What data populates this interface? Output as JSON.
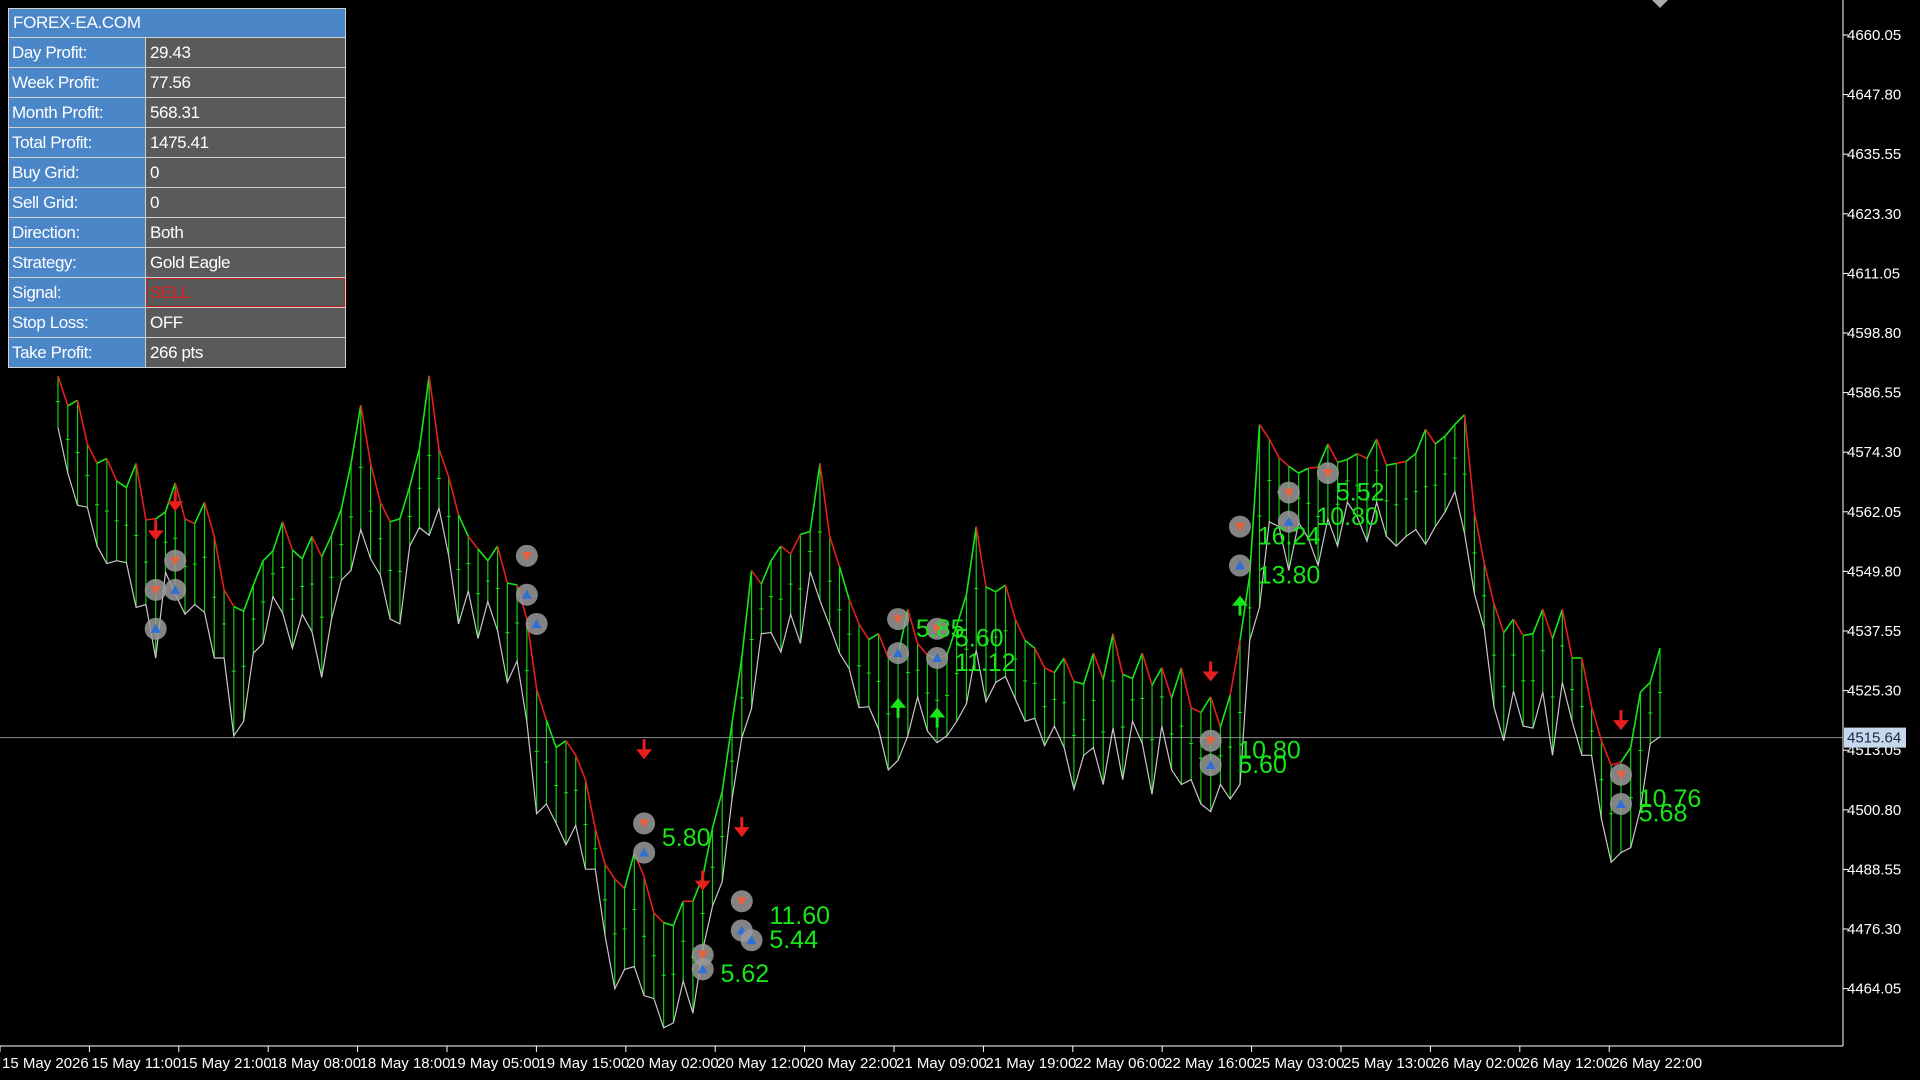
{
  "panel": {
    "title": "FOREX-EA.COM",
    "rows": [
      {
        "label": "Day Profit:",
        "value": "29.43"
      },
      {
        "label": "Week Profit:",
        "value": "77.56"
      },
      {
        "label": "Month Profit:",
        "value": "568.31"
      },
      {
        "label": "Total Profit:",
        "value": "1475.41"
      },
      {
        "label": "Buy Grid:",
        "value": "0"
      },
      {
        "label": "Sell Grid:",
        "value": "0"
      },
      {
        "label": "Direction:",
        "value": "Both"
      },
      {
        "label": "Strategy:",
        "value": "Gold Eagle"
      },
      {
        "label": "Signal:",
        "value": "SELL"
      },
      {
        "label": "Stop Loss:",
        "value": "OFF"
      },
      {
        "label": "Take Profit:",
        "value": "266 pts"
      }
    ]
  },
  "colors": {
    "background": "#000000",
    "up": "#19e619",
    "down": "#e61e1e",
    "wick": "#c8c8c8",
    "axis": "#ffffff",
    "panel_label_bg": "#4a86c8",
    "panel_value_bg": "#5a5a5a",
    "signal_sell": "#e02020",
    "current_price_box": "#c8d8ec"
  },
  "chart_data": {
    "type": "line",
    "current_price": "4515.64",
    "y_ticks": [
      "4660.05",
      "4647.80",
      "4635.55",
      "4623.30",
      "4611.05",
      "4598.80",
      "4586.55",
      "4574.30",
      "4562.05",
      "4549.80",
      "4537.55",
      "4525.30",
      "4513.05",
      "4500.80",
      "4488.55",
      "4476.30",
      "4464.05"
    ],
    "ylim": [
      4457.9,
      4666.2
    ],
    "x_ticks": [
      "15 May 2026",
      "15 May 11:00",
      "15 May 21:00",
      "18 May 08:00",
      "18 May 18:00",
      "19 May 05:00",
      "19 May 15:00",
      "20 May 02:00",
      "20 May 12:00",
      "20 May 22:00",
      "21 May 09:00",
      "21 May 19:00",
      "22 May 06:00",
      "22 May 16:00",
      "25 May 03:00",
      "25 May 13:00",
      "26 May 02:00",
      "26 May 12:00",
      "26 May 22:00"
    ],
    "series": [
      {
        "values": [
          4588,
          4580,
          4583,
          4570,
          4566,
          4571,
          4560,
          4565,
          4570,
          4552,
          4545,
          4560,
          4566,
          4555,
          4550,
          4562,
          4555,
          4540,
          4528,
          4535,
          4545,
          4550,
          4552,
          4558,
          4548,
          4548,
          4555,
          4543,
          4548,
          4560,
          4570,
          4582,
          4570,
          4555,
          4550,
          4553,
          4562,
          4573,
          4588,
          4573,
          4565,
          4555,
          4555,
          4549,
          4550,
          4553,
          4541,
          4545,
          4538,
          4515,
          4510,
          4510,
          4513,
          4510,
          4505,
          4495,
          4485,
          4478,
          4475,
          4490,
          4485,
          4470,
          4468,
          4475,
          4480,
          4472,
          4478,
          4495,
          4500,
          4510,
          4530,
          4548,
          4545,
          4550,
          4553,
          4550,
          4548,
          4556,
          4570,
          4555,
          4540,
          4542,
          4537,
          4530,
          4535,
          4525,
          4520,
          4540,
          4533,
          4527,
          4530,
          4523,
          4530,
          4543,
          4557,
          4535,
          4543,
          4545,
          4538,
          4525,
          4532,
          4528,
          4525,
          4530,
          4520,
          4520,
          4531,
          4522,
          4535,
          4520,
          4525,
          4531,
          4518,
          4528,
          4520,
          4528,
          4515,
          4514,
          4522,
          4515,
          4516,
          4512,
          4547,
          4578,
          4575,
          4570,
          4565,
          4568,
          4569,
          4567,
          4574,
          4568,
          4570,
          4572,
          4570,
          4575,
          4568,
          4570,
          4565,
          4572,
          4577,
          4568,
          4575,
          4578,
          4580,
          4560,
          4545,
          4533,
          4530,
          4538,
          4530,
          4535,
          4540,
          4525,
          4540,
          4530,
          4530,
          4520,
          4510,
          4505,
          4500,
          4505,
          4523,
          4525,
          4532
        ]
      }
    ],
    "annotations": [
      "5.80",
      "5.62",
      "11.60",
      "5.44",
      "5.85",
      "5.60",
      "11.12",
      "16.24",
      "13.80",
      "10.80",
      "5.52",
      "10.80",
      "5.60",
      "10.76",
      "5.68"
    ]
  }
}
